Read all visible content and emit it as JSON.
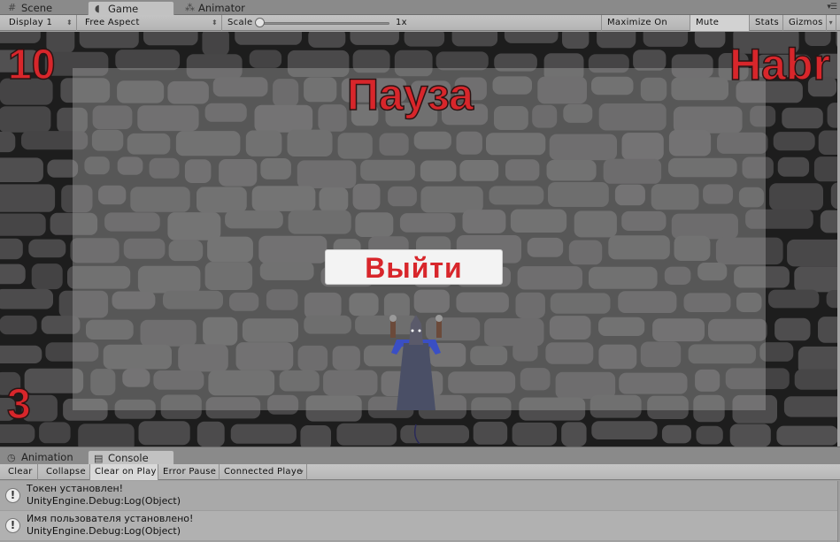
{
  "editor_tabs": [
    {
      "label": "Scene",
      "icon": "grid-icon",
      "active": false
    },
    {
      "label": "Game",
      "icon": "pacman-icon",
      "active": true
    },
    {
      "label": "Animator",
      "icon": "animator-nodes-icon",
      "active": false
    }
  ],
  "game_toolbar": {
    "display": "Display 1",
    "aspect": "Free Aspect",
    "scale_label": "Scale",
    "scale_value": "1x",
    "scale_slider_fraction": 0,
    "maximize_on_play": "Maximize On Play",
    "mute_audio": "Mute Audio",
    "stats": "Stats",
    "gizmos": "Gizmos"
  },
  "game_view": {
    "score": "10",
    "lives": "3",
    "brand": "Habr",
    "pause_title": "Пауза",
    "exit_button": "Выйти",
    "accent_color": "#d8262b"
  },
  "bottom_tabs": [
    {
      "label": "Animation",
      "icon": "clock-icon",
      "active": false
    },
    {
      "label": "Console",
      "icon": "console-icon",
      "active": true
    }
  ],
  "console_toolbar": {
    "clear": "Clear",
    "collapse": "Collapse",
    "clear_on_play": "Clear on Play",
    "error_pause": "Error Pause",
    "connected_player": "Connected Playe"
  },
  "console_logs": [
    {
      "message": "Токен установлен!",
      "trace": "UnityEngine.Debug:Log(Object)",
      "icon": "info-icon"
    },
    {
      "message": "Имя пользователя установлено!",
      "trace": "UnityEngine.Debug:Log(Object)",
      "icon": "info-icon"
    }
  ]
}
